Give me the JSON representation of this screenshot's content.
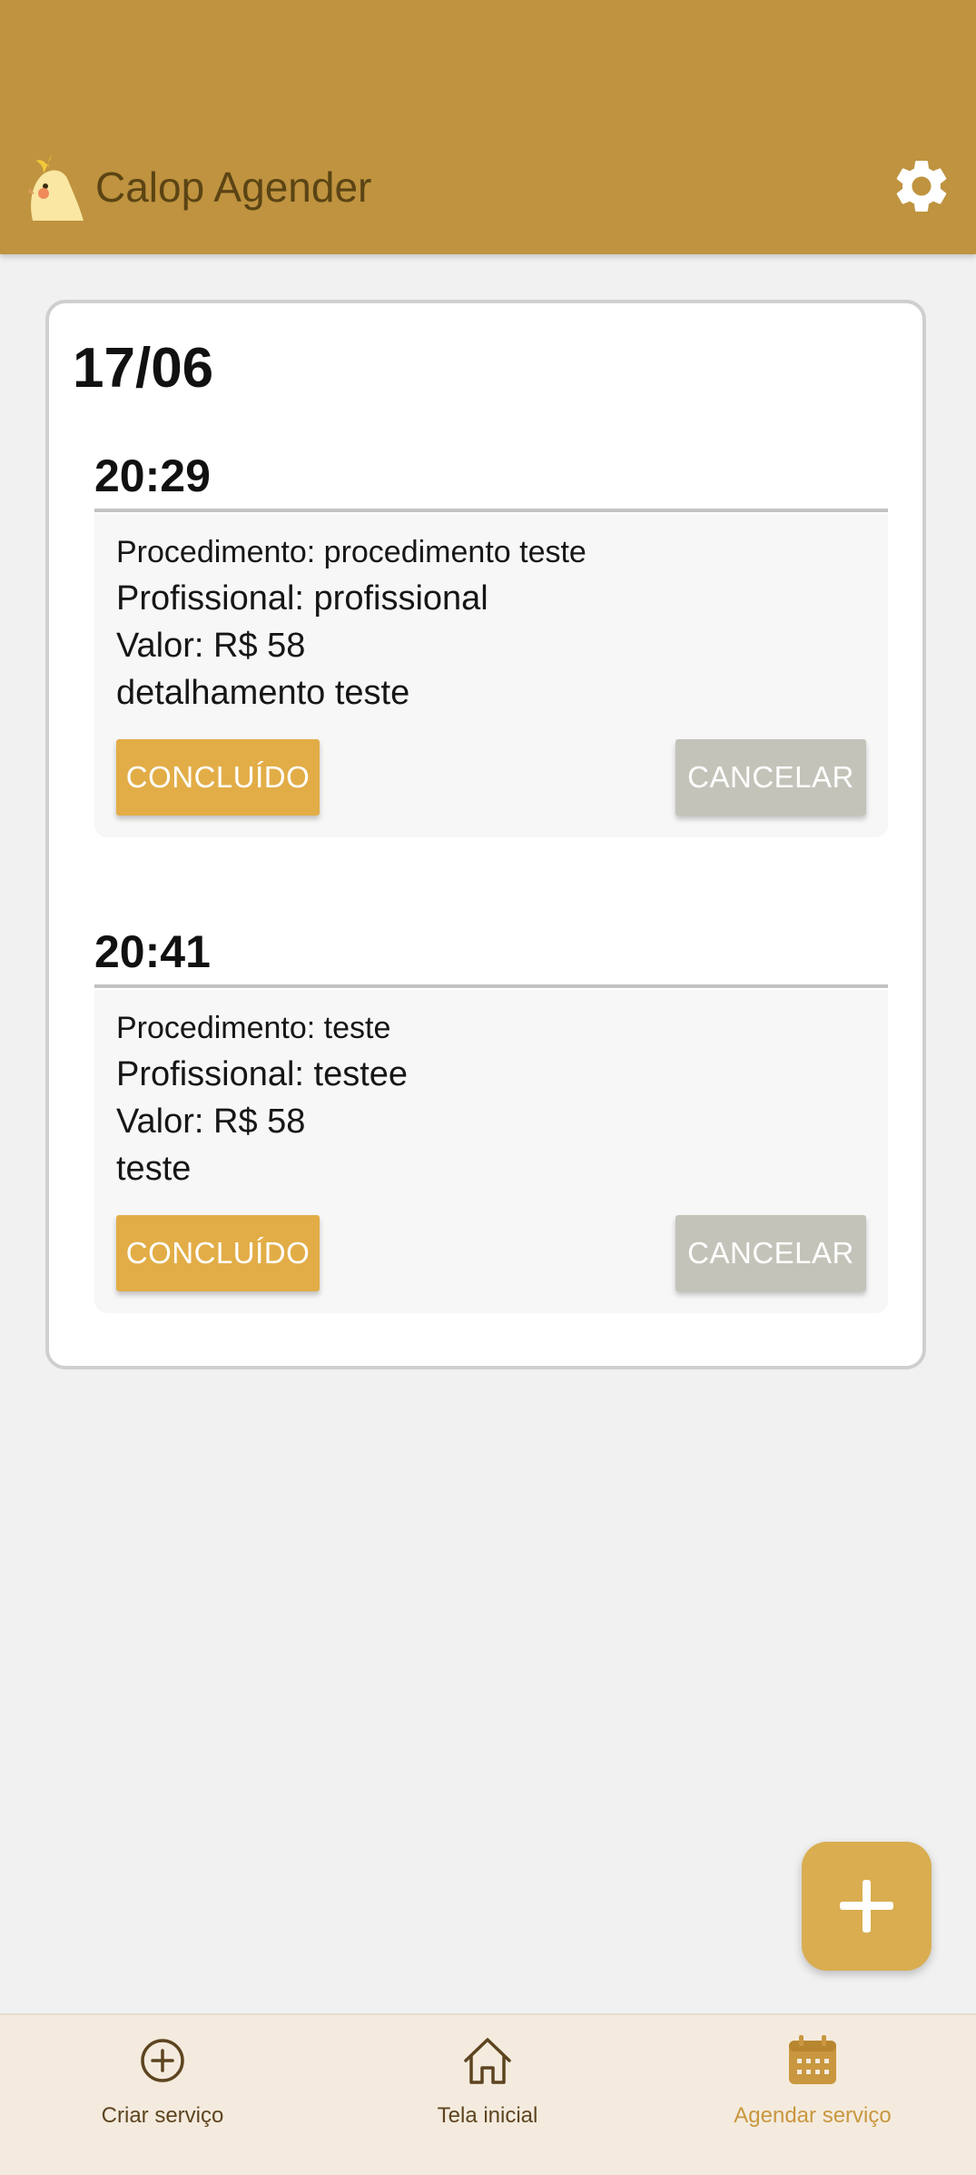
{
  "app": {
    "title": "Calop Agender"
  },
  "schedule": {
    "date": "17/06",
    "appointments": [
      {
        "time": "20:29",
        "procedure": "Procedimento: procedimento teste",
        "professional": "Profissional: profissional",
        "price": "Valor: R$ 58",
        "details": "detalhamento teste",
        "done_label": "CONCLUÍDO",
        "cancel_label": "CANCELAR"
      },
      {
        "time": "20:41",
        "procedure": "Procedimento: teste",
        "professional": "Profissional: testee",
        "price": "Valor: R$ 58",
        "details": "teste",
        "done_label": "CONCLUÍDO",
        "cancel_label": "CANCELAR"
      }
    ]
  },
  "nav": {
    "items": [
      {
        "label": "Criar serviço",
        "icon": "plus-circle-icon",
        "active": false
      },
      {
        "label": "Tela inicial",
        "icon": "home-icon",
        "active": false
      },
      {
        "label": "Agendar serviço",
        "icon": "calendar-icon",
        "active": true
      }
    ]
  },
  "icons": {
    "logo": "cockatiel-icon",
    "settings": "gear-icon",
    "fab": "plus-icon"
  },
  "colors": {
    "appbar": "#bf933f",
    "title_text": "#5b4414",
    "done_button": "#e2ad47",
    "cancel_button": "#c4c3b9",
    "fab": "#d9ad50",
    "nav_background": "#f4ebde",
    "nav_active": "#c9973f"
  }
}
